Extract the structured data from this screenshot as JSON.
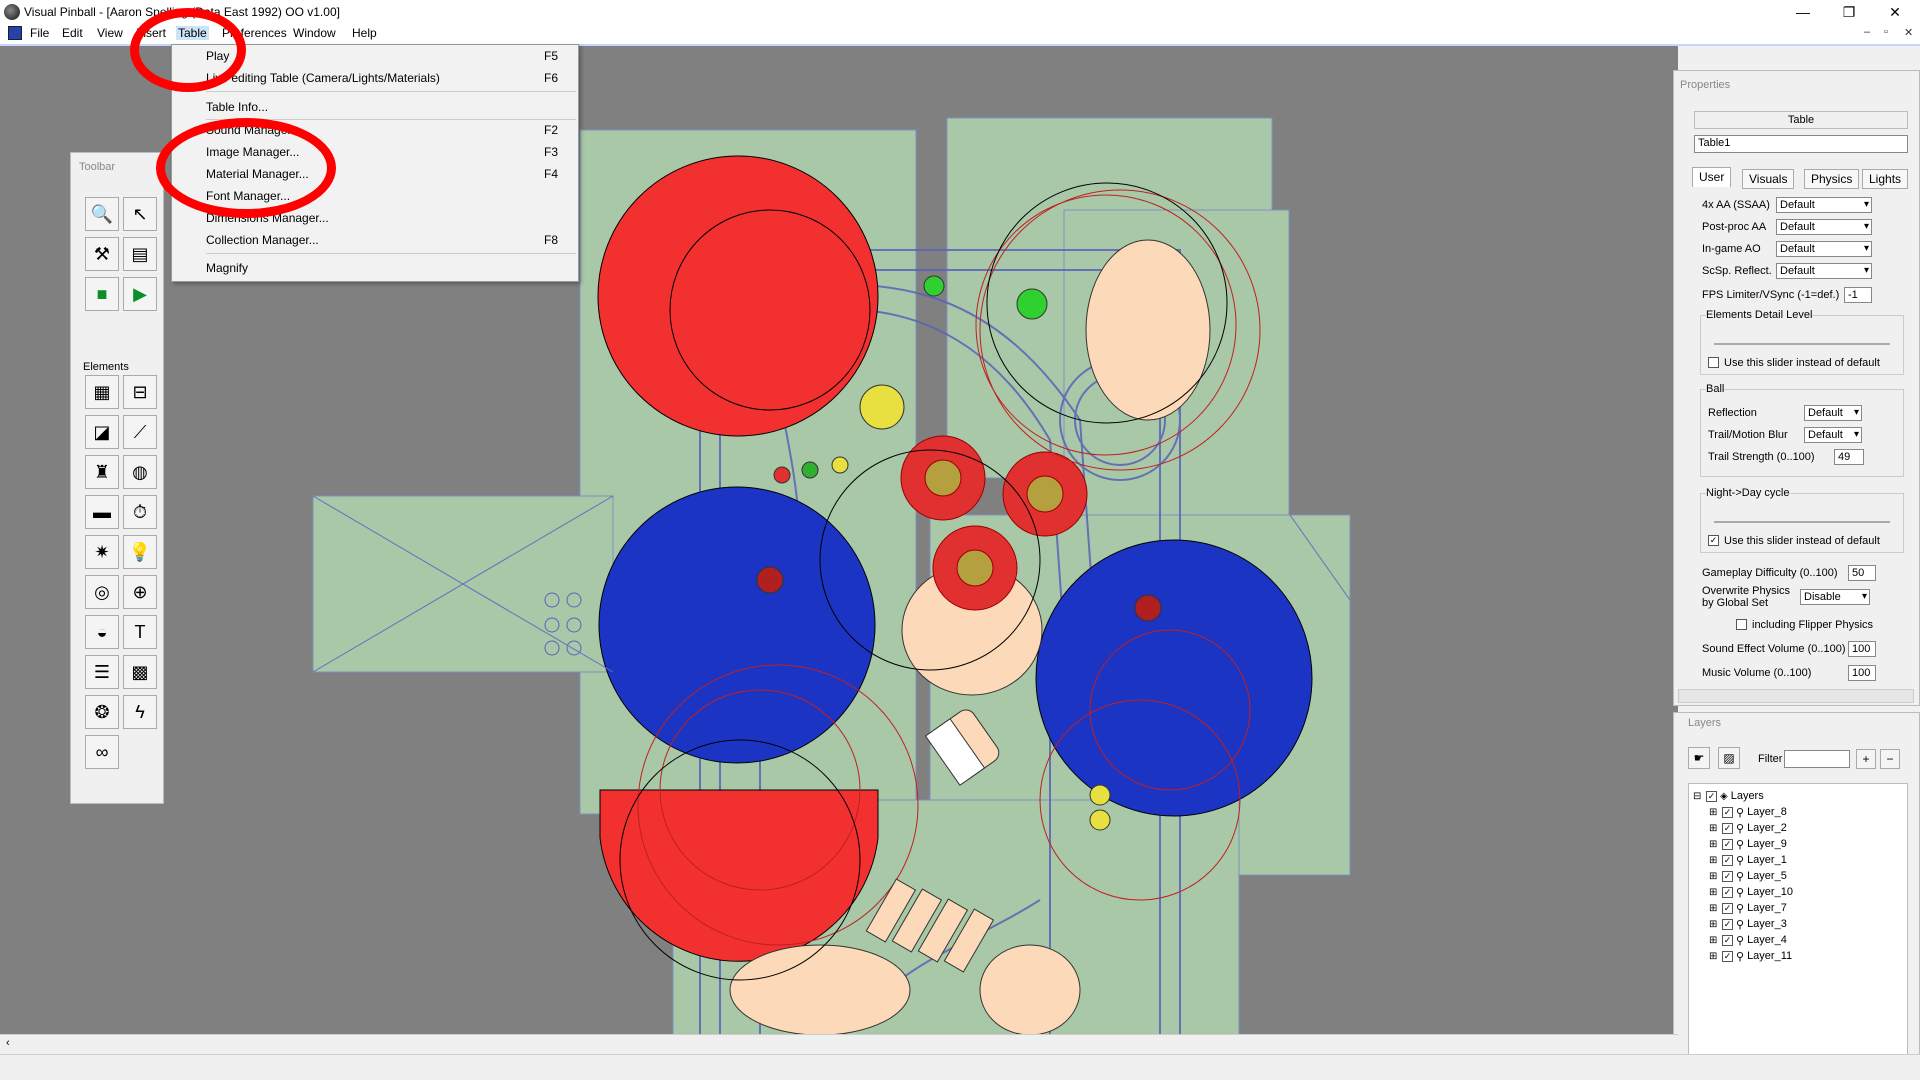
{
  "window": {
    "title": "Visual Pinball - [Aaron Spelling (Data East 1992) OO v1.00]",
    "minimize": "—",
    "maximize": "❐",
    "close": "✕"
  },
  "menubar": {
    "items": [
      "File",
      "Edit",
      "View",
      "Insert",
      "Table",
      "Preferences",
      "Window",
      "Help"
    ]
  },
  "table_menu": {
    "items": [
      {
        "label": "Play",
        "shortcut": "F5"
      },
      {
        "label": "Live editing Table (Camera/Lights/Materials)",
        "shortcut": "F6"
      },
      {
        "label": "Table Info...",
        "shortcut": ""
      },
      {
        "label": "Sound Manager...",
        "shortcut": "F2"
      },
      {
        "label": "Image Manager...",
        "shortcut": "F3"
      },
      {
        "label": "Material Manager...",
        "shortcut": "F4"
      },
      {
        "label": "Font Manager...",
        "shortcut": ""
      },
      {
        "label": "Dimensions Manager...",
        "shortcut": ""
      },
      {
        "label": "Collection Manager...",
        "shortcut": "F8"
      },
      {
        "label": "Magnify",
        "shortcut": ""
      }
    ]
  },
  "toolbar": {
    "title": "Toolbar",
    "elements_title": "Elements"
  },
  "properties": {
    "title": "Properties",
    "object_type": "Table",
    "object_name": "Table1",
    "tabs": [
      "User",
      "Visuals",
      "Physics",
      "Lights"
    ],
    "fields": {
      "aa_label": "4x AA (SSAA)",
      "aa_value": "Default",
      "postproc_label": "Post-proc AA",
      "postproc_value": "Default",
      "ao_label": "In-game AO",
      "ao_value": "Default",
      "scsp_label": "ScSp. Reflect.",
      "scsp_value": "Default",
      "fps_label": "FPS Limiter/VSync (-1=def.)",
      "fps_value": "-1",
      "detail_group": "Elements Detail Level",
      "detail_check": "Use this slider instead of default",
      "ball_group": "Ball",
      "reflection_label": "Reflection",
      "reflection_value": "Default",
      "trail_label": "Trail/Motion Blur",
      "trail_value": "Default",
      "trail_strength_label": "Trail Strength (0..100)",
      "trail_strength_value": "49",
      "night_group": "Night->Day cycle",
      "night_check": "Use this slider instead of default",
      "difficulty_label": "Gameplay Difficulty (0..100)",
      "difficulty_value": "50",
      "overwrite_label_1": "Overwrite Physics",
      "overwrite_label_2": "by Global Set",
      "overwrite_value": "Disable",
      "flipper_check": "including Flipper Physics",
      "sound_label": "Sound Effect Volume (0..100)",
      "sound_value": "100",
      "music_label": "Music Volume (0..100)",
      "music_value": "100"
    }
  },
  "layers": {
    "title": "Layers",
    "filter_label": "Filter",
    "root": "Layers",
    "items": [
      "Layer_8",
      "Layer_2",
      "Layer_9",
      "Layer_1",
      "Layer_5",
      "Layer_10",
      "Layer_7",
      "Layer_3",
      "Layer_4",
      "Layer_11"
    ]
  },
  "colors": {
    "accent_annotation": "#ff0000",
    "playfield_bg": "#a8c8a8",
    "workspace_bg": "#808080"
  }
}
